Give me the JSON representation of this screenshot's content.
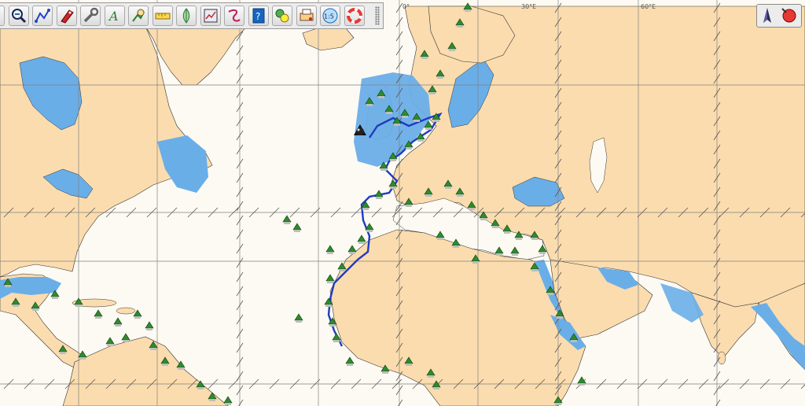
{
  "window": {
    "title": ""
  },
  "grid_labels": {
    "lon_0": "0°",
    "lon_30": "30°E",
    "lon_60": "60°E"
  },
  "toolbar": {
    "buttons": [
      {
        "name": "zoom-out-button",
        "icon": "magnifier-minus-icon"
      },
      {
        "name": "zoom-in-button",
        "icon": "magnifier-plus-icon"
      },
      {
        "name": "route-button",
        "icon": "route-icon"
      },
      {
        "name": "boat-button",
        "icon": "boat-icon"
      },
      {
        "name": "settings-button",
        "icon": "wrench-icon"
      },
      {
        "name": "text-mark-button",
        "icon": "text-mark-icon"
      },
      {
        "name": "mark-button",
        "icon": "mark-pin-icon"
      },
      {
        "name": "measure-button",
        "icon": "ruler-icon"
      },
      {
        "name": "tides-button",
        "icon": "tides-icon"
      },
      {
        "name": "log-button",
        "icon": "log-icon"
      },
      {
        "name": "track-button",
        "icon": "track-icon"
      },
      {
        "name": "help-button",
        "icon": "help-icon"
      },
      {
        "name": "layers-button",
        "icon": "layers-icon"
      },
      {
        "name": "print-button",
        "icon": "print-icon"
      },
      {
        "name": "scale-button",
        "icon": "scale-icon",
        "label": "1:5"
      },
      {
        "name": "mob-button",
        "icon": "lifebuoy-icon"
      }
    ]
  },
  "compass": {
    "icon": "north-arrow-icon",
    "status": "status-red-dot-icon"
  },
  "colors": {
    "sea": "#fdfaf3",
    "land": "#fbdcae",
    "shallow_water": "#6aaee8",
    "marker_green": "#2e8b2e",
    "track_blue": "#1f3cc2",
    "grid": "#808080"
  }
}
